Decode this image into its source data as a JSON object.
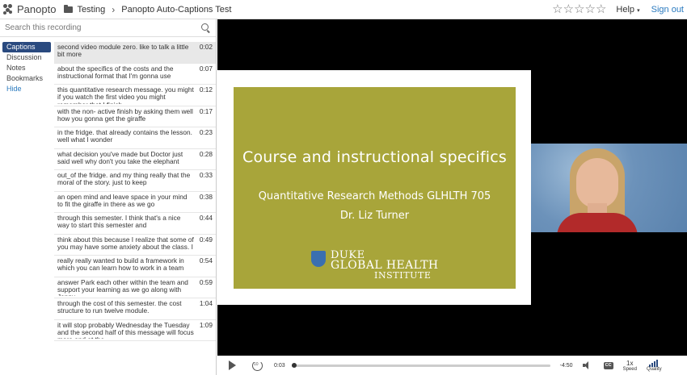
{
  "header": {
    "logo": "Panopto",
    "folder": "Testing",
    "title": "Panopto Auto-Captions Test",
    "help_label": "Help",
    "signout_label": "Sign out",
    "stars": 5
  },
  "sidebar": {
    "search_placeholder": "Search this recording",
    "nav": [
      {
        "label": "Captions",
        "active": true
      },
      {
        "label": "Discussion"
      },
      {
        "label": "Notes"
      },
      {
        "label": "Bookmarks"
      },
      {
        "label": "Hide"
      }
    ],
    "captions": [
      {
        "text": "second video module zero. like to talk a little bit more",
        "time": "0:02",
        "active": true
      },
      {
        "text": "about the specifics of the costs and the instructional format that I'm gonna use",
        "time": "0:07"
      },
      {
        "text": "this quantitative research message. you might if you watch the first video you might remember that I finish",
        "time": "0:12"
      },
      {
        "text": "with the non- active finish by asking them well how you gonna get the giraffe",
        "time": "0:17"
      },
      {
        "text": "in the fridge. that already contains the lesson. well what I wonder",
        "time": "0:23"
      },
      {
        "text": "what decision you've made but Doctor just said well why don't you take the elephant",
        "time": "0:28"
      },
      {
        "text": "out_of the fridge. and my thing really that the moral of the story. just to keep",
        "time": "0:33"
      },
      {
        "text": "an open mind and leave space in your mind to fit the giraffe in there as we go",
        "time": "0:38"
      },
      {
        "text": "through this semester. I think that's a nice way to start this semester and",
        "time": "0:44"
      },
      {
        "text": "think about this because I realize that some of you may have some anxiety about the class. I",
        "time": "0:49"
      },
      {
        "text": "really really wanted to build a framework in which you can learn how to work in a team",
        "time": "0:54"
      },
      {
        "text": "answer Park each other within the team and support your learning as we go along with Jenny.",
        "time": "0:59"
      },
      {
        "text": "through the cost of this semester. the cost structure to run twelve module.",
        "time": "1:04"
      },
      {
        "text": "it will stop probably Wednesday the Tuesday and the second half of this message will focus more and at the",
        "time": "1:09"
      }
    ]
  },
  "slide": {
    "title": "Course and instructional specifics",
    "subtitle": "Quantitative Research Methods GLHLTH 705",
    "author": "Dr. Liz Turner",
    "logo_line1": "DUKE",
    "logo_line2": "GLOBAL HEALTH",
    "logo_line3": "INSTITUTE"
  },
  "player": {
    "current_time": "0:03",
    "remaining_time": "-4:50",
    "progress": 0.01,
    "speed_value": "1x",
    "speed_label": "Speed",
    "quality_label": "Quality",
    "cc_label": "CC"
  },
  "colors": {
    "slide_bg": "#a8a53a",
    "accent": "#2a4a7f",
    "link": "#2a7abf"
  }
}
